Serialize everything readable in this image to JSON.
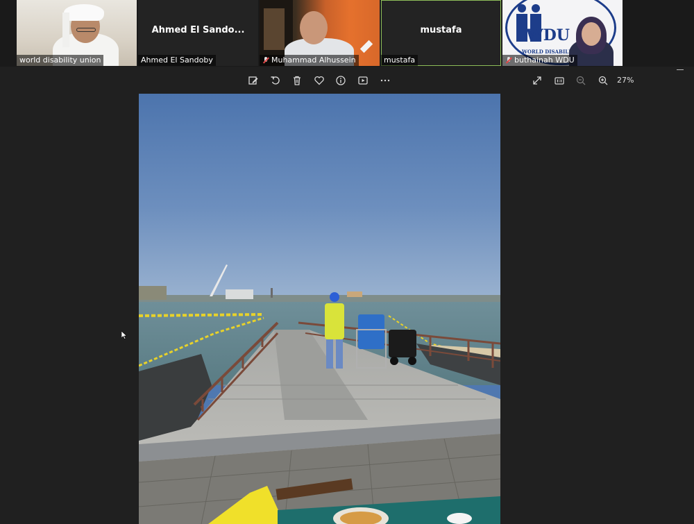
{
  "participants": [
    {
      "name": "world disability union",
      "center_name": "",
      "video": true,
      "muted": false
    },
    {
      "name": "Ahmed El Sandoby",
      "center_name": "Ahmed El Sando...",
      "video": false,
      "muted": false
    },
    {
      "name": "Muhammad Alhussein",
      "center_name": "",
      "video": true,
      "muted": true
    },
    {
      "name": "mustafa",
      "center_name": "mustafa",
      "video": false,
      "muted": false,
      "active": true
    },
    {
      "name": "buthainah WDU",
      "center_name": "",
      "video": true,
      "muted": true
    }
  ],
  "logo_text": "WDU",
  "logo_subtext": "WORLD DISABILITY",
  "toolbar": {
    "icons": [
      "edit-icon",
      "rotate-icon",
      "delete-icon",
      "heart-icon",
      "info-icon",
      "slideshow-icon",
      "more-icon"
    ],
    "right_icons": [
      "fullscreen-icon",
      "actual-size-icon",
      "zoom-out-icon",
      "zoom-in-icon"
    ],
    "zoom_level": "27%"
  },
  "colors": {
    "background": "#202020",
    "active_tile_border": "#8fbf5a",
    "mute_red": "#e34848"
  }
}
